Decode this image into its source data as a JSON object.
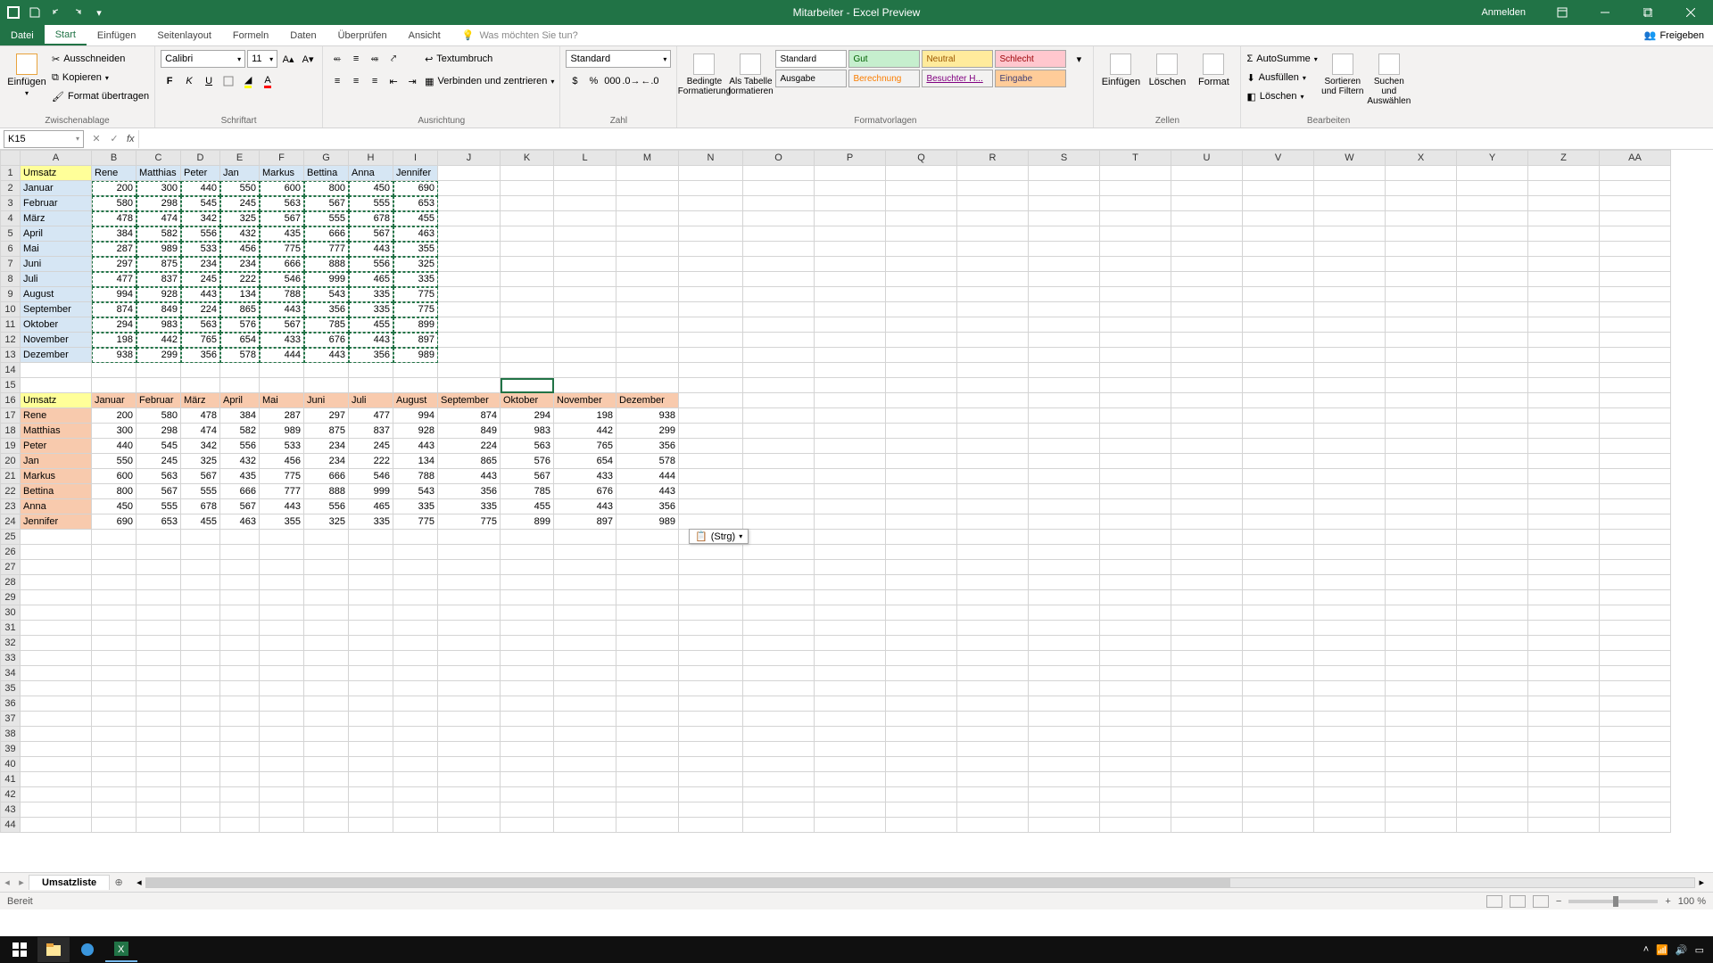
{
  "title": "Mitarbeiter  -  Excel Preview",
  "signin": "Anmelden",
  "tabs": {
    "file": "Datei",
    "home": "Start",
    "insert": "Einfügen",
    "layout": "Seitenlayout",
    "formulas": "Formeln",
    "data": "Daten",
    "review": "Überprüfen",
    "view": "Ansicht",
    "tell": "Was möchten Sie tun?",
    "share": "Freigeben"
  },
  "clipboard": {
    "paste": "Einfügen",
    "cut": "Ausschneiden",
    "copy": "Kopieren",
    "fmt": "Format übertragen",
    "grouplabel": "Zwischenablage"
  },
  "font": {
    "name": "Calibri",
    "size": "11",
    "grouplabel": "Schriftart"
  },
  "align": {
    "wrap": "Textumbruch",
    "merge": "Verbinden und zentrieren",
    "grouplabel": "Ausrichtung"
  },
  "number": {
    "format": "Standard",
    "grouplabel": "Zahl"
  },
  "styles": {
    "cond": "Bedingte Formatierung",
    "table": "Als Tabelle formatieren",
    "standard": "Standard",
    "gut": "Gut",
    "neutral": "Neutral",
    "schlecht": "Schlecht",
    "ausgabe": "Ausgabe",
    "berechnung": "Berechnung",
    "besucht": "Besuchter H...",
    "eingabe": "Eingabe",
    "grouplabel": "Formatvorlagen"
  },
  "cells": {
    "insert": "Einfügen",
    "delete": "Löschen",
    "format": "Format",
    "grouplabel": "Zellen"
  },
  "editing": {
    "sum": "AutoSumme",
    "fill": "Ausfüllen",
    "clear": "Löschen",
    "sort": "Sortieren und Filtern",
    "find": "Suchen und Auswählen",
    "grouplabel": "Bearbeiten"
  },
  "namebox": "K15",
  "pasteopt": "(Strg)",
  "sheetname": "Umsatzliste",
  "status": "Bereit",
  "zoom": "100 %",
  "chart_data": {
    "type": "table",
    "table1": {
      "corner": "Umsatz",
      "cols": [
        "Rene",
        "Matthias",
        "Peter",
        "Jan",
        "Markus",
        "Bettina",
        "Anna",
        "Jennifer"
      ],
      "rows": [
        "Januar",
        "Februar",
        "März",
        "April",
        "Mai",
        "Juni",
        "Juli",
        "August",
        "September",
        "Oktober",
        "November",
        "Dezember"
      ],
      "values": [
        [
          200,
          300,
          440,
          550,
          600,
          800,
          450,
          690
        ],
        [
          580,
          298,
          545,
          245,
          563,
          567,
          555,
          653
        ],
        [
          478,
          474,
          342,
          325,
          567,
          555,
          678,
          455
        ],
        [
          384,
          582,
          556,
          432,
          435,
          666,
          567,
          463
        ],
        [
          287,
          989,
          533,
          456,
          775,
          777,
          443,
          355
        ],
        [
          297,
          875,
          234,
          234,
          666,
          888,
          556,
          325
        ],
        [
          477,
          837,
          245,
          222,
          546,
          999,
          465,
          335
        ],
        [
          994,
          928,
          443,
          134,
          788,
          543,
          335,
          775
        ],
        [
          874,
          849,
          224,
          865,
          443,
          356,
          335,
          775
        ],
        [
          294,
          983,
          563,
          576,
          567,
          785,
          455,
          899
        ],
        [
          198,
          442,
          765,
          654,
          433,
          676,
          443,
          897
        ],
        [
          938,
          299,
          356,
          578,
          444,
          443,
          356,
          989
        ]
      ]
    },
    "table2": {
      "corner": "Umsatz",
      "cols": [
        "Januar",
        "Februar",
        "März",
        "April",
        "Mai",
        "Juni",
        "Juli",
        "August",
        "September",
        "Oktober",
        "November",
        "Dezember"
      ],
      "rows": [
        "Rene",
        "Matthias",
        "Peter",
        "Jan",
        "Markus",
        "Bettina",
        "Anna",
        "Jennifer"
      ],
      "values": [
        [
          200,
          580,
          478,
          384,
          287,
          297,
          477,
          994,
          874,
          294,
          198,
          938
        ],
        [
          300,
          298,
          474,
          582,
          989,
          875,
          837,
          928,
          849,
          983,
          442,
          299
        ],
        [
          440,
          545,
          342,
          556,
          533,
          234,
          245,
          443,
          224,
          563,
          765,
          356
        ],
        [
          550,
          245,
          325,
          432,
          456,
          234,
          222,
          134,
          865,
          576,
          654,
          578
        ],
        [
          600,
          563,
          567,
          435,
          775,
          666,
          546,
          788,
          443,
          567,
          433,
          444
        ],
        [
          800,
          567,
          555,
          666,
          777,
          888,
          999,
          543,
          356,
          785,
          676,
          443
        ],
        [
          450,
          555,
          678,
          567,
          443,
          556,
          465,
          335,
          335,
          455,
          443,
          356
        ],
        [
          690,
          653,
          455,
          463,
          355,
          325,
          335,
          775,
          775,
          899,
          897,
          989
        ]
      ]
    }
  },
  "cols": [
    "A",
    "B",
    "C",
    "D",
    "E",
    "F",
    "G",
    "H",
    "I",
    "J",
    "K",
    "L",
    "M",
    "N",
    "O",
    "P",
    "Q",
    "R",
    "S",
    "T",
    "U",
    "V",
    "W",
    "X",
    "Y",
    "Z",
    "AA"
  ]
}
